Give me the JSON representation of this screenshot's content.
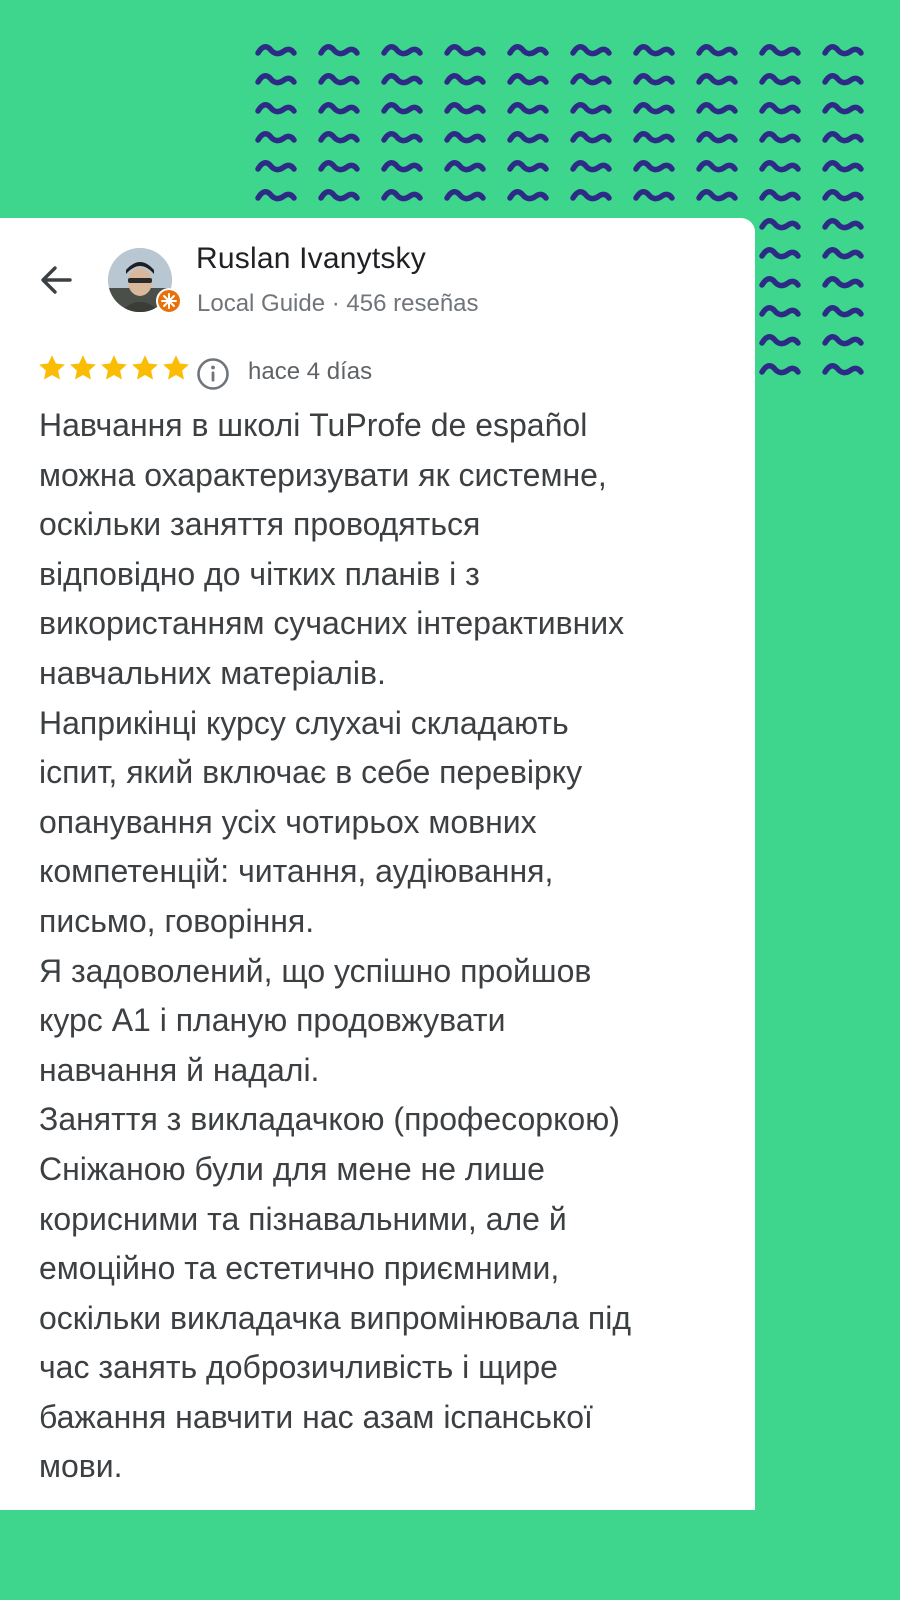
{
  "colors": {
    "background": "#3dd68c",
    "pattern": "#2e2b86",
    "star": "#fbbc04",
    "badge": "#e8710a",
    "card": "#ffffff"
  },
  "reviewer": {
    "name": "Ruslan Ivanytsky",
    "meta": "Local Guide · 456 reseñas",
    "badge_icon": "local-guide-badge-icon"
  },
  "review": {
    "rating": 5,
    "date": "hace 4 días",
    "lines": [
      "Навчання в школі TuProfe de español",
      "можна охарактеризувати як системне,",
      "оскільки заняття проводяться",
      "відповідно до чітких планів і з",
      "використанням сучасних інтерактивних",
      "навчальних матеріалів.",
      "Наприкінці курсу слухачі складають",
      "іспит, який включає в себе перевірку",
      "опанування усіх чотирьох мовних",
      "компетенцій: читання, аудіювання,",
      "письмо, говоріння.",
      "Я задоволений, що успішно пройшов",
      "курс А1 і планую продовжувати",
      "навчання й надалі.",
      "Заняття з викладачкою (професоркою)",
      "Сніжаною були для мене не лише",
      "корисними та пізнавальними, але й",
      "емоційно та естетично приємними,",
      "оскільки викладачка випромінювала під",
      "час занять доброзичливість і щире",
      "бажання навчити нас азам іспанської",
      "мови."
    ]
  },
  "icons": {
    "back": "arrow-left-icon",
    "info": "info-icon",
    "star": "star-icon"
  }
}
